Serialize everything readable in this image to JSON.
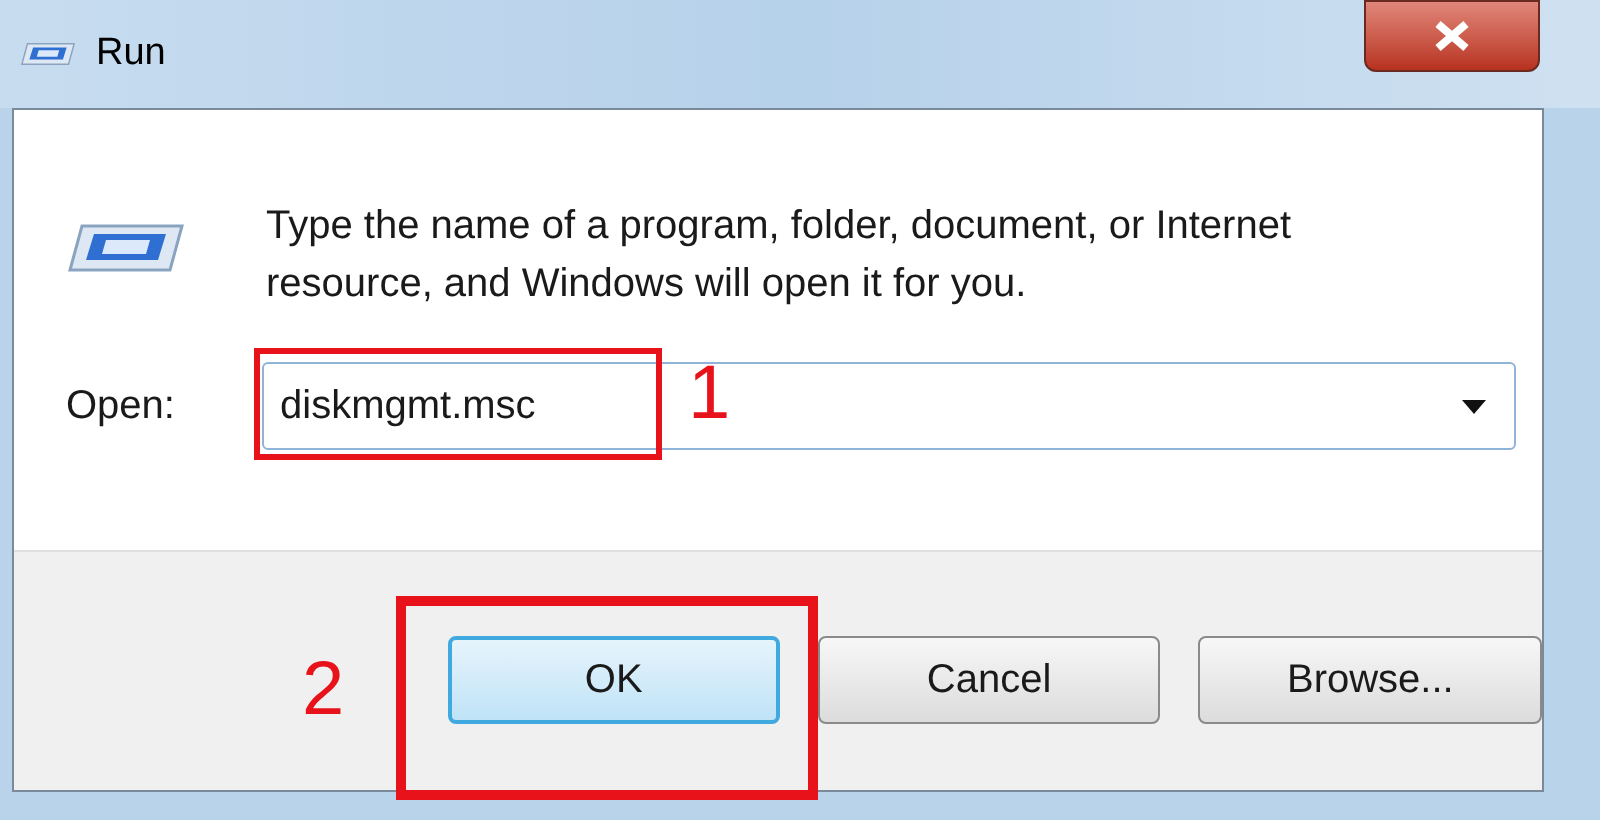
{
  "window": {
    "title": "Run"
  },
  "prompt": "Type the name of a program, folder, document, or Internet resource, and Windows will open it for you.",
  "open_field": {
    "label": "Open:",
    "value": "diskmgmt.msc",
    "step_number": "1"
  },
  "buttons": [
    {
      "label": "OK",
      "selected": true,
      "step_number": "2"
    },
    {
      "label": "Cancel",
      "selected": false
    },
    {
      "label": "Browse...",
      "selected": false
    }
  ]
}
